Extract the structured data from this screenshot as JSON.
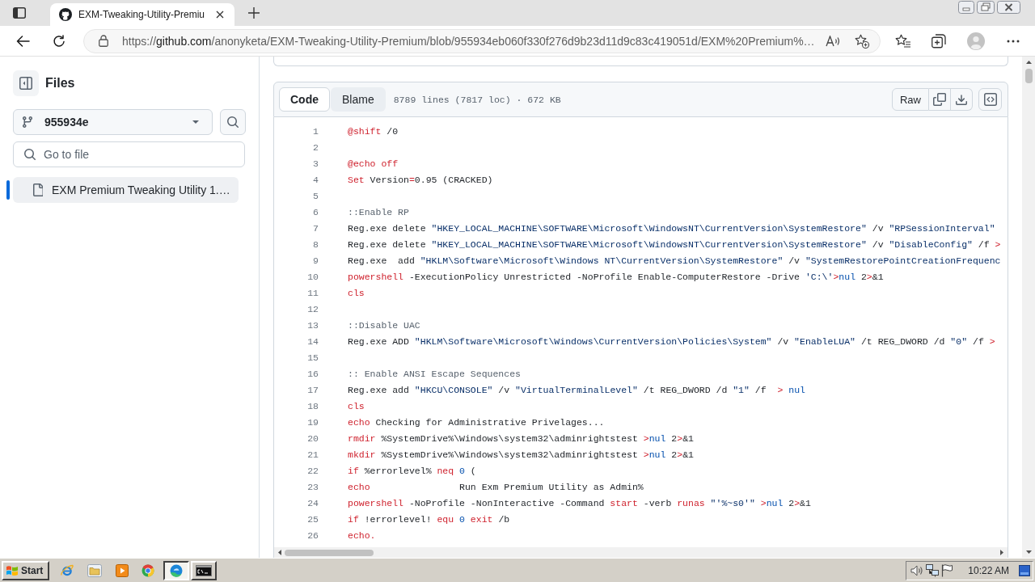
{
  "browser": {
    "tab": {
      "title": "EXM-Tweaking-Utility-Premiu"
    },
    "address": {
      "scheme": "https://",
      "host": "github.com",
      "path": "/anonyketa/EXM-Tweaking-Utility-Premium/blob/955934eb060f330f276d9b23d11d9c83c419051d/EXM%20Premium%…"
    }
  },
  "sidebar": {
    "title": "Files",
    "branch": "955934e",
    "search": {
      "placeholder": "Go to file"
    },
    "files": [
      {
        "name": "EXM Premium Tweaking Utility 1.…",
        "selected": true
      }
    ]
  },
  "code_view": {
    "tabs": [
      {
        "label": "Code",
        "selected": true
      },
      {
        "label": "Blame",
        "selected": false
      }
    ],
    "file_info": "8789 lines (7817 loc) · 672 KB",
    "raw_button": "Raw",
    "lines": [
      {
        "number": "1",
        "tokens": [
          {
            "kind": "keyword",
            "text": "@shift"
          },
          {
            "kind": "plain",
            "text": " /0"
          }
        ]
      },
      {
        "number": "2"
      },
      {
        "number": "3",
        "tokens": [
          {
            "kind": "keyword",
            "text": "@echo off"
          }
        ]
      },
      {
        "number": "4",
        "tokens": [
          {
            "kind": "keyword",
            "text": "Set"
          },
          {
            "kind": "plain",
            "text": " Version"
          },
          {
            "kind": "keyword",
            "text": "="
          },
          {
            "kind": "plain",
            "text": "0.95 (CRACKED)"
          }
        ]
      },
      {
        "number": "5"
      },
      {
        "number": "6",
        "tokens": [
          {
            "kind": "comment",
            "text": "::Enable RP"
          }
        ]
      },
      {
        "number": "7",
        "tokens": [
          {
            "kind": "plain",
            "text": "Reg.exe delete "
          },
          {
            "kind": "string",
            "text": "\"HKEY_LOCAL_MACHINE\\SOFTWARE\\Microsoft\\WindowsNT\\CurrentVersion\\SystemRestore\""
          },
          {
            "kind": "plain",
            "text": " /v "
          },
          {
            "kind": "string",
            "text": "\"RPSessionInterval\""
          }
        ]
      },
      {
        "number": "8",
        "tokens": [
          {
            "kind": "plain",
            "text": "Reg.exe delete "
          },
          {
            "kind": "string",
            "text": "\"HKEY_LOCAL_MACHINE\\SOFTWARE\\Microsoft\\WindowsNT\\CurrentVersion\\SystemRestore\""
          },
          {
            "kind": "plain",
            "text": " /v "
          },
          {
            "kind": "string",
            "text": "\"DisableConfig\""
          },
          {
            "kind": "plain",
            "text": " /f "
          },
          {
            "kind": "keyword",
            "text": ">"
          }
        ]
      },
      {
        "number": "9",
        "tokens": [
          {
            "kind": "plain",
            "text": "Reg.exe  add "
          },
          {
            "kind": "string",
            "text": "\"HKLM\\Software\\Microsoft\\Windows NT\\CurrentVersion\\SystemRestore\""
          },
          {
            "kind": "plain",
            "text": " /v "
          },
          {
            "kind": "string",
            "text": "\"SystemRestorePointCreationFrequenc"
          }
        ]
      },
      {
        "number": "10",
        "tokens": [
          {
            "kind": "keyword",
            "text": "powershell"
          },
          {
            "kind": "plain",
            "text": " -ExecutionPolicy Unrestricted -NoProfile Enable-ComputerRestore -Drive "
          },
          {
            "kind": "string",
            "text": "'C:\\'"
          },
          {
            "kind": "keyword",
            "text": ">"
          },
          {
            "kind": "constant",
            "text": "nul"
          },
          {
            "kind": "plain",
            "text": " 2"
          },
          {
            "kind": "keyword",
            "text": ">"
          },
          {
            "kind": "plain",
            "text": "&1"
          }
        ]
      },
      {
        "number": "11",
        "tokens": [
          {
            "kind": "keyword",
            "text": "cls"
          }
        ]
      },
      {
        "number": "12"
      },
      {
        "number": "13",
        "tokens": [
          {
            "kind": "comment",
            "text": "::Disable UAC"
          }
        ]
      },
      {
        "number": "14",
        "tokens": [
          {
            "kind": "plain",
            "text": "Reg.exe ADD "
          },
          {
            "kind": "string",
            "text": "\"HKLM\\Software\\Microsoft\\Windows\\CurrentVersion\\Policies\\System\""
          },
          {
            "kind": "plain",
            "text": " /v "
          },
          {
            "kind": "string",
            "text": "\"EnableLUA\""
          },
          {
            "kind": "plain",
            "text": " /t REG_DWORD /d "
          },
          {
            "kind": "string",
            "text": "\"0\""
          },
          {
            "kind": "plain",
            "text": " /f "
          },
          {
            "kind": "keyword",
            "text": ">"
          }
        ]
      },
      {
        "number": "15"
      },
      {
        "number": "16",
        "tokens": [
          {
            "kind": "comment",
            "text": ":: Enable ANSI Escape Sequences"
          }
        ]
      },
      {
        "number": "17",
        "tokens": [
          {
            "kind": "plain",
            "text": "Reg.exe add "
          },
          {
            "kind": "string",
            "text": "\"HKCU\\CONSOLE\""
          },
          {
            "kind": "plain",
            "text": " /v "
          },
          {
            "kind": "string",
            "text": "\"VirtualTerminalLevel\""
          },
          {
            "kind": "plain",
            "text": " /t REG_DWORD /d "
          },
          {
            "kind": "string",
            "text": "\"1\""
          },
          {
            "kind": "plain",
            "text": " /f  "
          },
          {
            "kind": "keyword",
            "text": ">"
          },
          {
            "kind": "constant",
            "text": " nul"
          }
        ]
      },
      {
        "number": "18",
        "tokens": [
          {
            "kind": "keyword",
            "text": "cls"
          }
        ]
      },
      {
        "number": "19",
        "tokens": [
          {
            "kind": "keyword",
            "text": "echo"
          },
          {
            "kind": "plain",
            "text": " Checking for Administrative Privelages..."
          }
        ]
      },
      {
        "number": "20",
        "tokens": [
          {
            "kind": "keyword",
            "text": "rmdir"
          },
          {
            "kind": "plain",
            "text": " %SystemDrive%\\Windows\\system32\\adminrightstest "
          },
          {
            "kind": "keyword",
            "text": ">"
          },
          {
            "kind": "constant",
            "text": "nul"
          },
          {
            "kind": "plain",
            "text": " 2"
          },
          {
            "kind": "keyword",
            "text": ">"
          },
          {
            "kind": "plain",
            "text": "&1"
          }
        ]
      },
      {
        "number": "21",
        "tokens": [
          {
            "kind": "keyword",
            "text": "mkdir"
          },
          {
            "kind": "plain",
            "text": " %SystemDrive%\\Windows\\system32\\adminrightstest "
          },
          {
            "kind": "keyword",
            "text": ">"
          },
          {
            "kind": "constant",
            "text": "nul"
          },
          {
            "kind": "plain",
            "text": " 2"
          },
          {
            "kind": "keyword",
            "text": ">"
          },
          {
            "kind": "plain",
            "text": "&1"
          }
        ]
      },
      {
        "number": "22",
        "tokens": [
          {
            "kind": "keyword",
            "text": "if"
          },
          {
            "kind": "plain",
            "text": " %errorlevel% "
          },
          {
            "kind": "keyword",
            "text": "neq"
          },
          {
            "kind": "constant",
            "text": " 0"
          },
          {
            "kind": "plain",
            "text": " ("
          }
        ]
      },
      {
        "number": "23",
        "tokens": [
          {
            "kind": "keyword",
            "text": "echo"
          },
          {
            "kind": "plain",
            "text": "                Run Exm Premium Utility as Admin%"
          }
        ]
      },
      {
        "number": "24",
        "tokens": [
          {
            "kind": "keyword",
            "text": "powershell"
          },
          {
            "kind": "plain",
            "text": " -NoProfile -NonInteractive -Command "
          },
          {
            "kind": "keyword",
            "text": "start"
          },
          {
            "kind": "plain",
            "text": " -verb "
          },
          {
            "kind": "keyword",
            "text": "runas"
          },
          {
            "kind": "string",
            "text": " \"'%~s0'\""
          },
          {
            "kind": "keyword",
            "text": " >"
          },
          {
            "kind": "constant",
            "text": "nul"
          },
          {
            "kind": "plain",
            "text": " 2"
          },
          {
            "kind": "keyword",
            "text": ">"
          },
          {
            "kind": "plain",
            "text": "&1"
          }
        ]
      },
      {
        "number": "25",
        "tokens": [
          {
            "kind": "keyword",
            "text": "if"
          },
          {
            "kind": "plain",
            "text": " !errorlevel! "
          },
          {
            "kind": "keyword",
            "text": "equ"
          },
          {
            "kind": "constant",
            "text": " 0"
          },
          {
            "kind": "keyword",
            "text": " exit"
          },
          {
            "kind": "plain",
            "text": " /b"
          }
        ]
      },
      {
        "number": "26",
        "tokens": [
          {
            "kind": "keyword",
            "text": "echo."
          }
        ]
      }
    ]
  },
  "taskbar": {
    "start": "Start",
    "quick_launch": [
      {
        "kind": "ie"
      },
      {
        "kind": "folder"
      },
      {
        "kind": "media"
      },
      {
        "kind": "chrome"
      }
    ],
    "tasks": [
      {
        "kind": "edge",
        "selected": true
      },
      {
        "kind": "console",
        "selected": false
      }
    ],
    "clock": "10:22 AM"
  }
}
